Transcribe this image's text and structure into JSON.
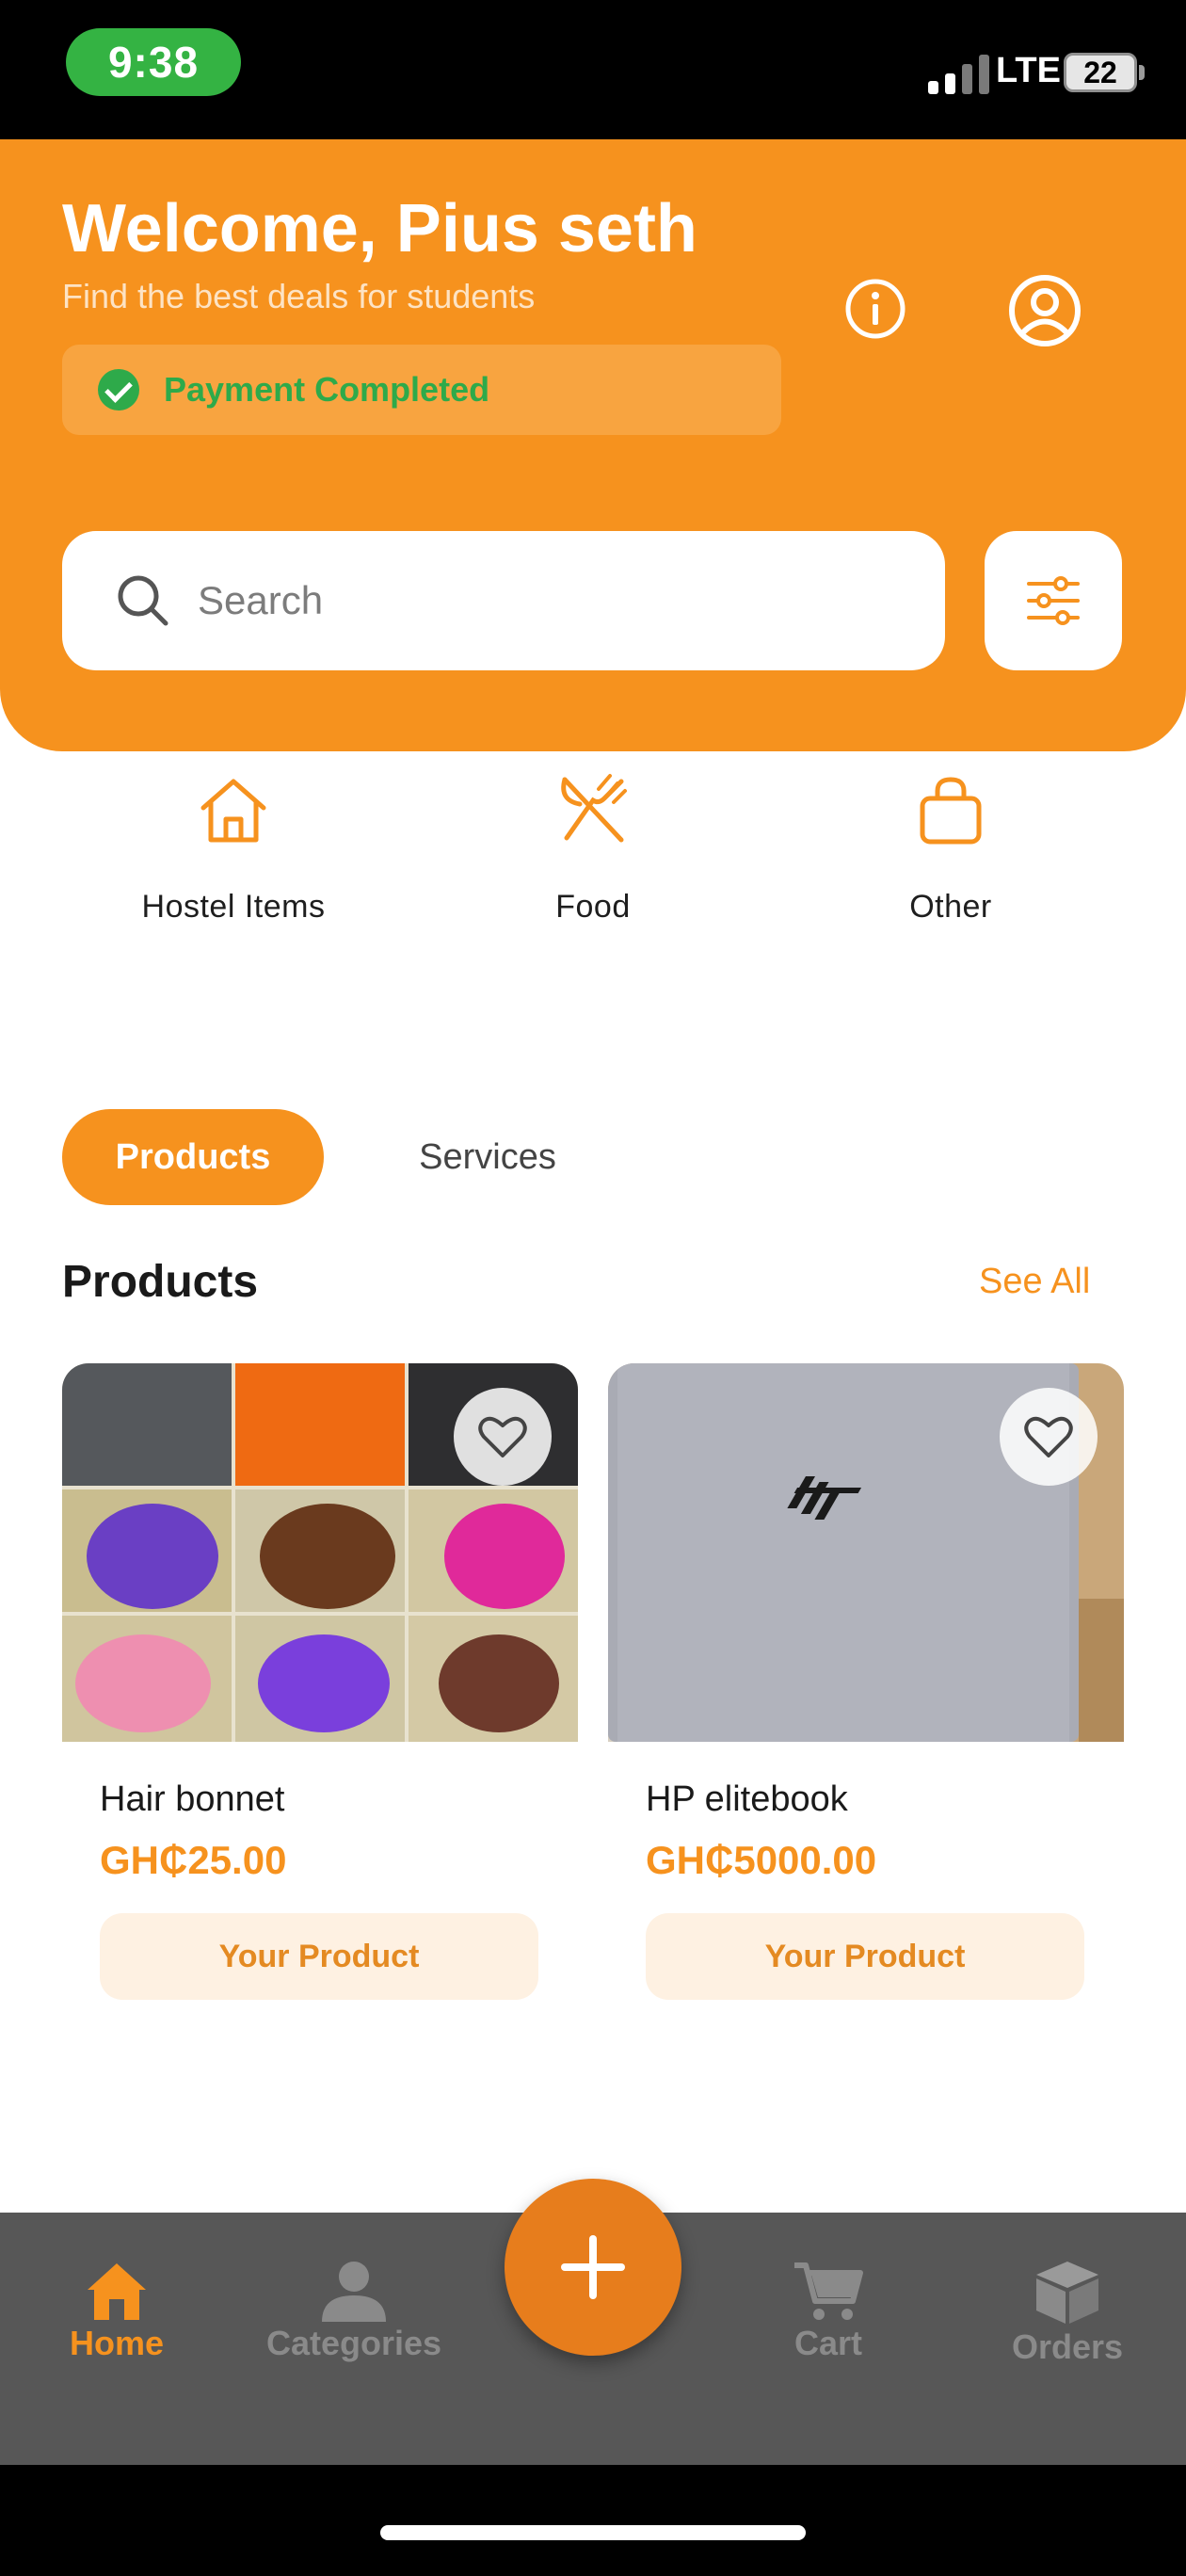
{
  "status_bar": {
    "time": "9:38",
    "network": "LTE",
    "battery": "22"
  },
  "header": {
    "welcome": "Welcome, Pius seth",
    "subtitle": "Find the best deals for students",
    "payment_status": "Payment Completed",
    "info_icon": "info-icon",
    "profile_icon": "user-circle-icon",
    "brand_color": "#f6921e"
  },
  "search": {
    "placeholder": "Search",
    "icon": "search-icon",
    "filter_icon": "sliders-icon"
  },
  "categories": [
    {
      "label": "Hostel Items",
      "icon": "house-icon"
    },
    {
      "label": "Food",
      "icon": "fork-knife-icon"
    },
    {
      "label": "Other",
      "icon": "shopping-bag-icon"
    }
  ],
  "tabs": [
    {
      "label": "Products",
      "active": true
    },
    {
      "label": "Services",
      "active": false
    }
  ],
  "products_section": {
    "title": "Products",
    "see_all": "See All",
    "items": [
      {
        "name": "Hair bonnet",
        "price": "GH₵25.00",
        "badge": "Your Product"
      },
      {
        "name": "HP elitebook",
        "price": "GH₵5000.00",
        "badge": "Your Product"
      }
    ]
  },
  "bottom_nav": {
    "items": [
      {
        "label": "Home",
        "icon": "home-icon",
        "active": true
      },
      {
        "label": "Categories",
        "icon": "person-icon",
        "active": false
      },
      {
        "label": "Cart",
        "icon": "cart-icon",
        "active": false
      },
      {
        "label": "Orders",
        "icon": "box-icon",
        "active": false
      }
    ],
    "fab_icon": "plus-icon"
  }
}
